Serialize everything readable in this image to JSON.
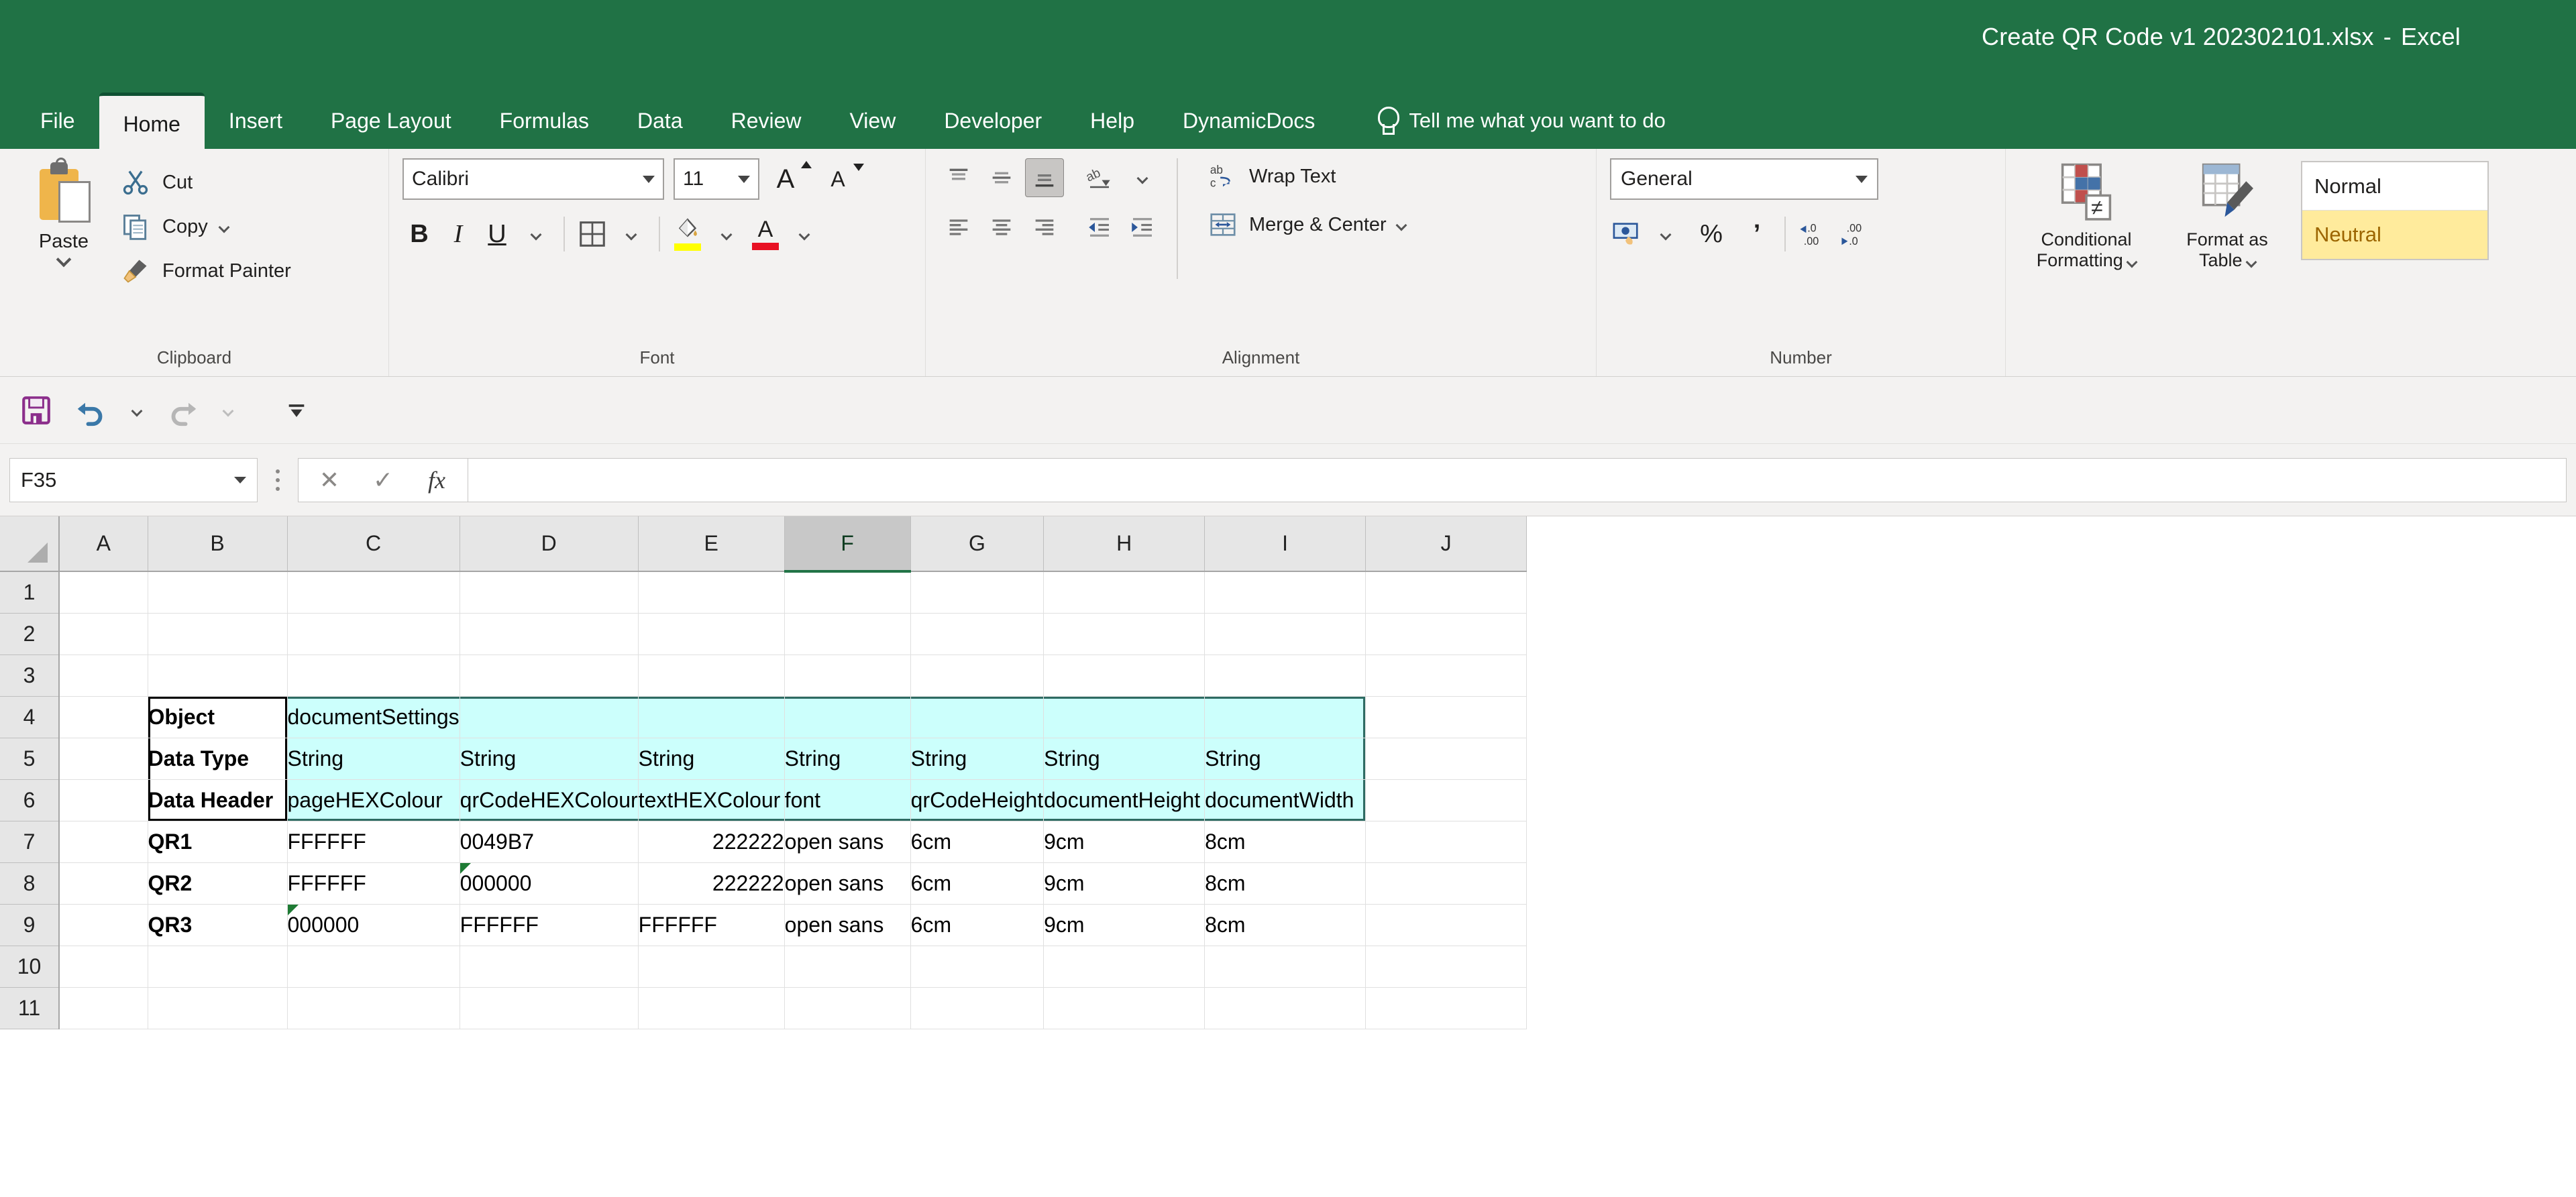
{
  "window": {
    "title": "Create QR Code v1 202302101.xlsx",
    "separator": "-",
    "app": "Excel"
  },
  "ribbon": {
    "tabs": [
      {
        "label": "File",
        "active": false
      },
      {
        "label": "Home",
        "active": true
      },
      {
        "label": "Insert",
        "active": false
      },
      {
        "label": "Page Layout",
        "active": false
      },
      {
        "label": "Formulas",
        "active": false
      },
      {
        "label": "Data",
        "active": false
      },
      {
        "label": "Review",
        "active": false
      },
      {
        "label": "View",
        "active": false
      },
      {
        "label": "Developer",
        "active": false
      },
      {
        "label": "Help",
        "active": false
      },
      {
        "label": "DynamicDocs",
        "active": false
      }
    ],
    "tell_me": "Tell me what you want to do",
    "groups": {
      "clipboard": {
        "label": "Clipboard",
        "paste": "Paste",
        "cut": "Cut",
        "copy": "Copy",
        "format_painter": "Format Painter"
      },
      "font": {
        "label": "Font",
        "font_name": "Calibri",
        "font_size": "11",
        "bold": "B",
        "italic": "I",
        "underline": "U",
        "highlight_color": "#FFFF00",
        "font_color": "#E81123"
      },
      "alignment": {
        "label": "Alignment",
        "wrap_text": "Wrap Text",
        "merge_center": "Merge & Center"
      },
      "number": {
        "label": "Number",
        "format": "General",
        "percent": "%",
        "comma": "’",
        "inc_decimal": ".00",
        "dec_decimal": ".0"
      },
      "styles": {
        "conditional_formatting": "Conditional\nFormatting",
        "conditional_formatting_line1": "Conditional",
        "conditional_formatting_line2": "Formatting",
        "format_as_table_line1": "Format as",
        "format_as_table_line2": "Table",
        "style_normal": "Normal",
        "style_neutral": "Neutral"
      }
    }
  },
  "quick_access": {
    "save": "save-icon",
    "undo": "undo-icon",
    "redo": "redo-icon",
    "customize": "customize-icon"
  },
  "formula_bar": {
    "name_box": "F35",
    "cancel": "✕",
    "enter": "✓",
    "insert_function": "fx",
    "formula": ""
  },
  "grid": {
    "columns": [
      "A",
      "B",
      "C",
      "D",
      "E",
      "F",
      "G",
      "H",
      "I",
      "J"
    ],
    "highlighted_column": "F",
    "rows": [
      "1",
      "2",
      "3",
      "4",
      "5",
      "6",
      "7",
      "8",
      "9",
      "10",
      "11"
    ],
    "cells": {
      "B4": "Object",
      "C4": "documentSettings",
      "B5": "Data Type",
      "C5": "String",
      "D5": "String",
      "E5": "String",
      "F5": "String",
      "G5": "String",
      "H5": "String",
      "I5": "String",
      "B6": "Data Header",
      "C6": "pageHEXColour",
      "D6": "qrCodeHEXColour",
      "E6": "textHEXColour",
      "F6": "font",
      "G6": "qrCodeHeight",
      "H6": "documentHeight",
      "I6": "documentWidth",
      "B7": "QR1",
      "C7": "FFFFFF",
      "D7": "0049B7",
      "E7": "222222",
      "F7": "open sans",
      "G7": "6cm",
      "H7": "9cm",
      "I7": "8cm",
      "B8": "QR2",
      "C8": "FFFFFF",
      "D8": "000000",
      "E8": "222222",
      "F8": "open sans",
      "G8": "6cm",
      "H8": "9cm",
      "I8": "8cm",
      "B9": "QR3",
      "C9": "000000",
      "D9": "FFFFFF",
      "E9": "FFFFFF",
      "F9": "open sans",
      "G9": "6cm",
      "H9": "9cm",
      "I9": "8cm"
    },
    "error_indicator_cells": [
      "D8",
      "C9"
    ],
    "highlight_fill": "#CCFFFC",
    "header_fill": "#E6E6E6",
    "accent": "#217346"
  }
}
